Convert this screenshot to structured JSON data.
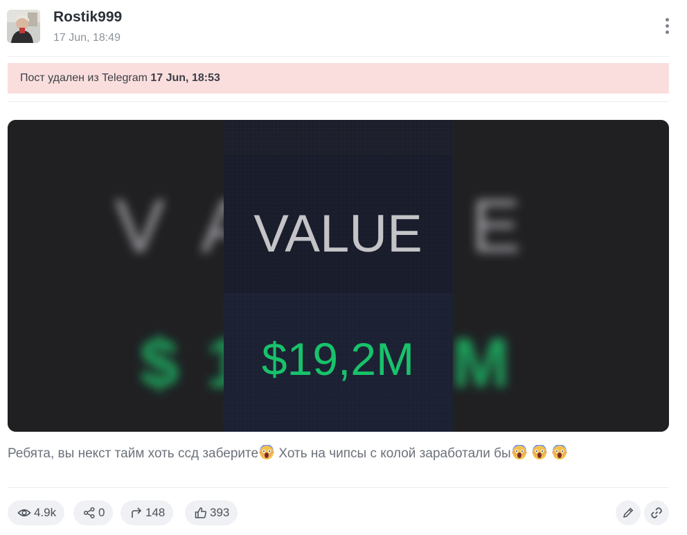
{
  "post": {
    "author": "Rostik999",
    "date": "17 Jun, 18:49"
  },
  "notice": {
    "text": "Пост удален из Telegram ",
    "timestamp": "17 Jun, 18:53",
    "background": "#fadedd"
  },
  "media": {
    "label": "VALUE",
    "value": "$19,2M",
    "value_color": "#18c26a"
  },
  "caption": {
    "part1": "Ребята, вы некст тайм хоть ссд заберите",
    "part2": " Хоть на чипсы с колой заработали бы",
    "emoji": "screaming-face-emoji"
  },
  "stats": {
    "views": "4.9k",
    "shares": "0",
    "forwards": "148",
    "likes": "393"
  },
  "icons": {
    "views": "eye-icon",
    "shares": "share-icon",
    "forwards": "forward-icon",
    "likes": "thumbs-up-icon",
    "edit": "pencil-icon",
    "link": "link-icon",
    "menu": "kebab-menu-icon"
  }
}
